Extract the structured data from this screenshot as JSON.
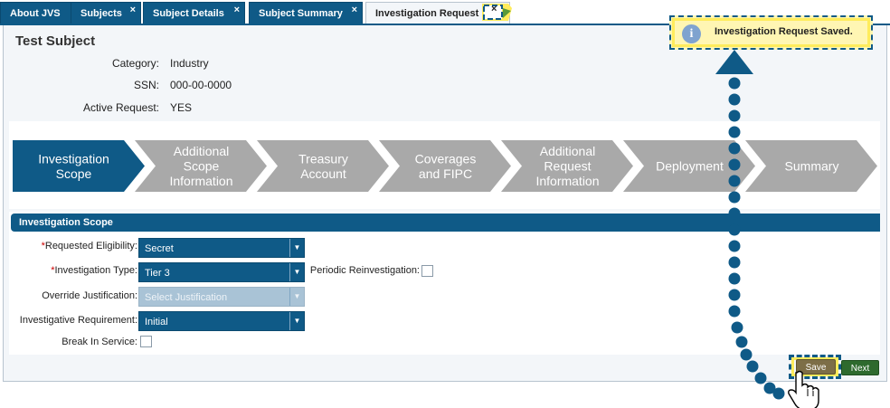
{
  "tabs": [
    {
      "label": "About JVS",
      "closable": false
    },
    {
      "label": "Subjects",
      "closable": true
    },
    {
      "label": "Subject Details",
      "closable": true
    },
    {
      "label": "Subject Summary",
      "closable": true
    },
    {
      "label": "Investigation Request",
      "closable": true,
      "active": true
    }
  ],
  "close_glyph": "×",
  "subject": {
    "name": "Test Subject",
    "fields": [
      {
        "label": "Category:",
        "value": "Industry"
      },
      {
        "label": "SSN:",
        "value": "000-00-0000"
      },
      {
        "label": "Active Request:",
        "value": "YES"
      }
    ]
  },
  "wizard": {
    "steps": [
      {
        "label": "Investigation Scope",
        "lines": [
          "Investigation",
          "Scope"
        ],
        "active": true
      },
      {
        "label": "Additional Scope Information",
        "lines": [
          "Additional",
          "Scope",
          "Information"
        ],
        "active": false
      },
      {
        "label": "Treasury Account",
        "lines": [
          "Treasury",
          "Account"
        ],
        "active": false
      },
      {
        "label": "Coverages and FIPC",
        "lines": [
          "Coverages",
          "and FIPC"
        ],
        "active": false
      },
      {
        "label": "Additional Request Information",
        "lines": [
          "Additional",
          "Request",
          "Information"
        ],
        "active": false
      },
      {
        "label": "Deployment",
        "lines": [
          "Deployment"
        ],
        "active": false
      },
      {
        "label": "Summary",
        "lines": [
          "Summary"
        ],
        "active": false
      }
    ]
  },
  "scope": {
    "title": "Investigation Scope",
    "requested_eligibility": {
      "label": "Requested Eligibility:",
      "value": "Secret",
      "required": true
    },
    "investigation_type": {
      "label": "Investigation Type:",
      "value": "Tier 3",
      "required": true
    },
    "periodic_reinvestigation": {
      "label": "Periodic Reinvestigation:",
      "checked": false
    },
    "override_justification": {
      "label": "Override Justification:",
      "placeholder": "Select Justification",
      "disabled": true
    },
    "investigative_requirement": {
      "label": "Investigative Requirement:",
      "value": "Initial"
    },
    "break_in_service": {
      "label": "Break In Service:",
      "checked": false
    },
    "required_mark": "*",
    "dropdown_glyph": "▼"
  },
  "buttons": {
    "save": "Save",
    "next": "Next"
  },
  "notification": {
    "message": "Investigation Request Saved.",
    "icon": "info-icon",
    "icon_glyph": "i"
  },
  "colors": {
    "primary": "#0f5a87",
    "step_inactive": "#a9a9a9",
    "highlight": "#ffec5c",
    "save": "#7d6e47",
    "next": "#2e6a2e"
  }
}
